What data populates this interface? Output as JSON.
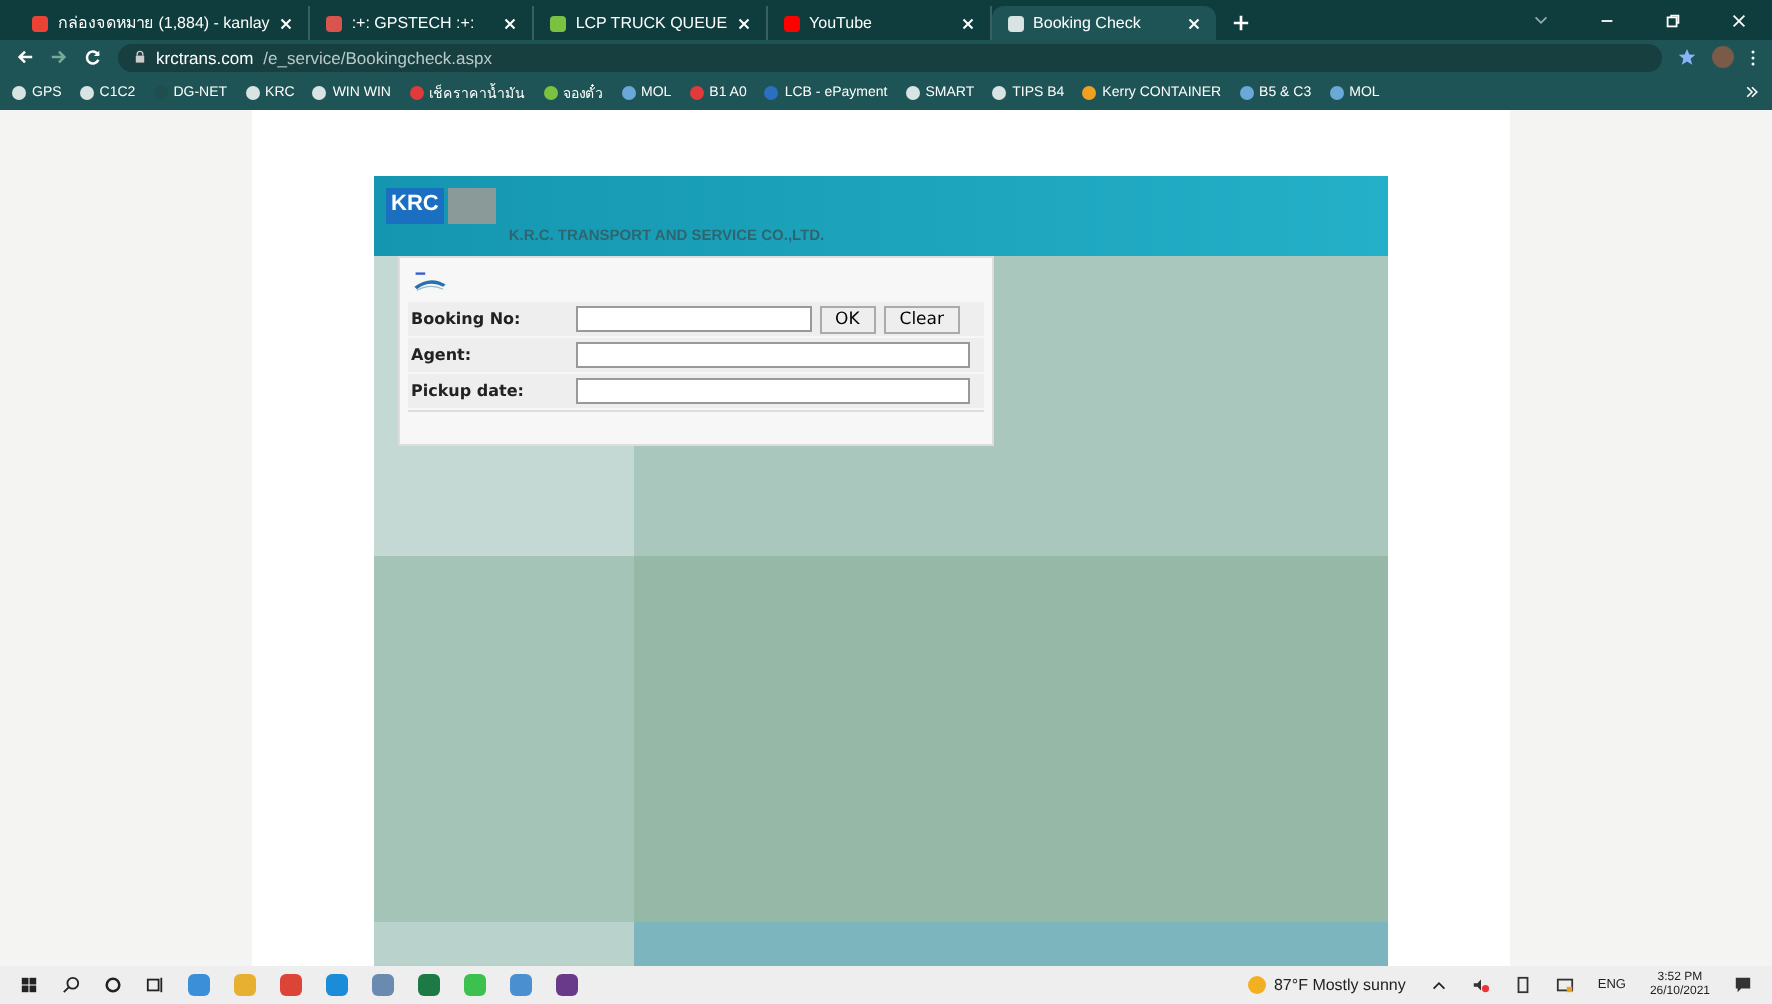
{
  "tabs": [
    {
      "title": "กล่องจดหมาย (1,884) - kanlay",
      "selected": false
    },
    {
      "title": ":+: GPSTECH :+:",
      "selected": false
    },
    {
      "title": "LCP TRUCK QUEUE",
      "selected": false
    },
    {
      "title": "YouTube",
      "selected": false
    },
    {
      "title": "Booking Check",
      "selected": true
    }
  ],
  "address": {
    "domain": "krctrans.com",
    "path": "/e_service/Bookingcheck.aspx"
  },
  "bookmarks": [
    {
      "label": "GPS"
    },
    {
      "label": "C1C2"
    },
    {
      "label": "DG-NET"
    },
    {
      "label": "KRC"
    },
    {
      "label": "WIN WIN"
    },
    {
      "label": "เช็คราคาน้ำมัน"
    },
    {
      "label": "จองตั๋ว"
    },
    {
      "label": "MOL"
    },
    {
      "label": "B1 A0"
    },
    {
      "label": "LCB - ePayment"
    },
    {
      "label": "SMART"
    },
    {
      "label": "TIPS B4"
    },
    {
      "label": "Kerry CONTAINER"
    },
    {
      "label": "B5 & C3"
    },
    {
      "label": "MOL"
    }
  ],
  "site": {
    "logo": "KRC",
    "company": "K.R.C. TRANSPORT AND SERVICE CO.,LTD."
  },
  "form": {
    "fields": [
      {
        "label": "Booking No:",
        "buttons": [
          "OK",
          "Clear"
        ]
      },
      {
        "label": "Agent:"
      },
      {
        "label": "Pickup date:"
      }
    ]
  },
  "taskbar": {
    "weather": "87°F Mostly sunny",
    "language": "ENG",
    "time": "3:52 PM",
    "date": "26/10/2021"
  }
}
